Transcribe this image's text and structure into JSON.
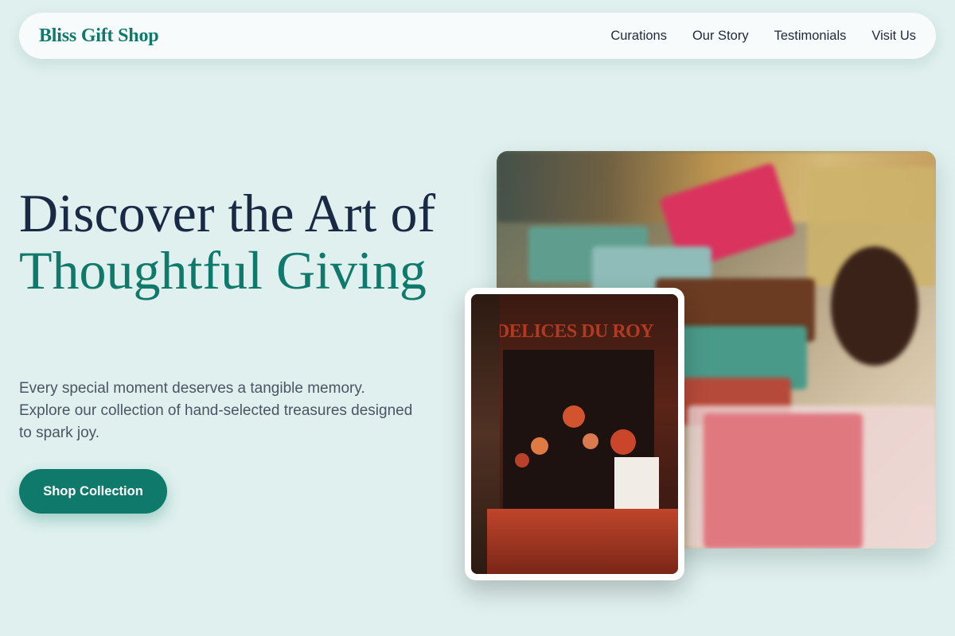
{
  "brand": {
    "name": "Bliss Gift Shop"
  },
  "nav": {
    "links": [
      {
        "label": "Curations"
      },
      {
        "label": "Our Story"
      },
      {
        "label": "Testimonials"
      },
      {
        "label": "Visit Us"
      }
    ]
  },
  "hero": {
    "title_line1": "Discover the Art of",
    "title_accent": "Thoughtful Giving",
    "subtitle": "Every special moment deserves a tangible memory. Explore our collection of hand-selected treasures designed to spark joy.",
    "cta_label": "Shop Collection"
  },
  "images": {
    "storefront_sign": "DELICES DU ROY"
  },
  "colors": {
    "accent": "#0f7a6c",
    "heading": "#1b2a44",
    "background": "#dff0ee"
  }
}
